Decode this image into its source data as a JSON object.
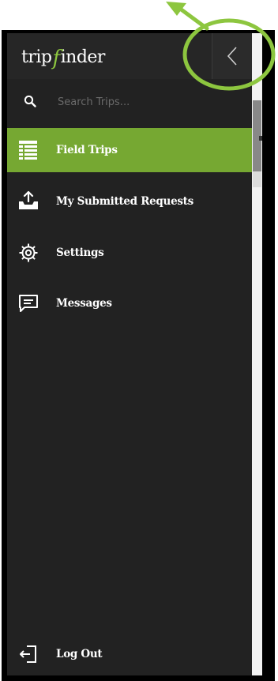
{
  "app": {
    "logo_text_left": "trip",
    "logo_text_f": "f",
    "logo_text_right": "inder"
  },
  "search": {
    "placeholder": "Search Trips..."
  },
  "nav": {
    "items": [
      {
        "label": "Field Trips",
        "icon": "table-list-icon",
        "active": true
      },
      {
        "label": "My Submitted Requests",
        "icon": "inbox-upload-icon",
        "active": false
      },
      {
        "label": "Settings",
        "icon": "gear-icon",
        "active": false
      },
      {
        "label": "Messages",
        "icon": "message-icon",
        "active": false
      }
    ],
    "logout_label": "Log Out"
  },
  "colors": {
    "accent": "#76a832",
    "annotation": "#8dc63f",
    "panel": "#222222"
  }
}
